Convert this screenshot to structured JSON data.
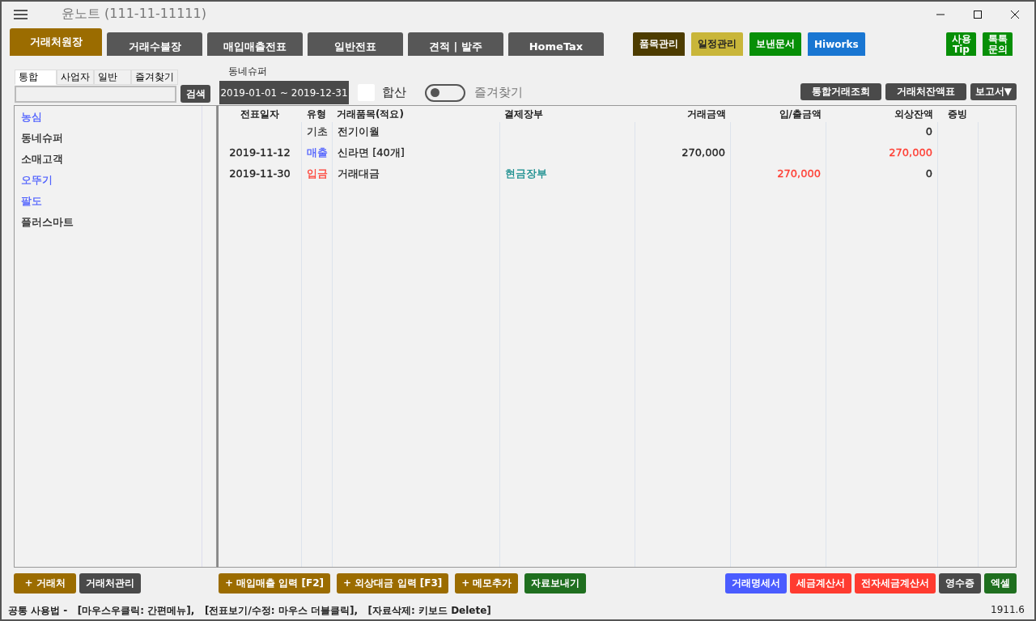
{
  "window": {
    "title": "윤노트 (111-11-11111)"
  },
  "main_tabs": [
    {
      "label": "거래처원장",
      "selected": true
    },
    {
      "label": "거래수불장",
      "selected": false
    },
    {
      "label": "매입매출전표",
      "selected": false
    },
    {
      "label": "일반전표",
      "selected": false
    },
    {
      "label": "견적 | 발주",
      "selected": false
    },
    {
      "label": "HomeTax",
      "selected": false
    }
  ],
  "tool_buttons": [
    {
      "label": "품목관리",
      "color": "#4d3c00"
    },
    {
      "label": "일정관리",
      "color": "#c9b63a"
    },
    {
      "label": "보낸문서",
      "color": "#078f07"
    },
    {
      "label": "Hiworks",
      "color": "#1976d2"
    }
  ],
  "help_buttons": [
    {
      "label": "사용\nTip",
      "color": "#078f07"
    },
    {
      "label": "톡톡\n문의",
      "color": "#078f07"
    }
  ],
  "filter_tabs": [
    {
      "label": "통합",
      "selected": true
    },
    {
      "label": "사업자",
      "selected": false
    },
    {
      "label": "일반",
      "selected": false
    },
    {
      "label": "즐겨찾기",
      "selected": false
    }
  ],
  "search_button": "검색",
  "selected_client": "동네슈퍼",
  "date_range": "2019-01-01 ~ 2019-12-31",
  "sum_checkbox": {
    "label": "합산",
    "checked": false
  },
  "favorite_toggle": {
    "label": "즐겨찾기",
    "on": false
  },
  "report_buttons": [
    {
      "label": "통합거래조회"
    },
    {
      "label": "거래처잔액표"
    },
    {
      "label": "보고서",
      "caret": "▼"
    }
  ],
  "clients": [
    {
      "name": "농심",
      "color": "#4a5cff"
    },
    {
      "name": "동네슈퍼",
      "color": "#222222"
    },
    {
      "name": "소매고객",
      "color": "#222222"
    },
    {
      "name": "오뚜기",
      "color": "#4a5cff"
    },
    {
      "name": "팔도",
      "color": "#4a5cff"
    },
    {
      "name": "플러스마트",
      "color": "#222222"
    }
  ],
  "table": {
    "columns": [
      "전표일자",
      "유형",
      "거래품목(적요)",
      "결제장부",
      "거래금액",
      "입/출금액",
      "외상잔액",
      "증빙"
    ],
    "rows": [
      {
        "type": {
          "text": "기초",
          "color": "#333333"
        },
        "item": "전기이월",
        "balance": {
          "text": "0",
          "color": "#222222"
        }
      },
      {
        "date": "2019-11-12",
        "type": {
          "text": "매출",
          "color": "#4a5cff"
        },
        "item": "신라면 [40개]",
        "amount": "270,000",
        "balance": {
          "text": "270,000",
          "color": "#ff3b30"
        }
      },
      {
        "date": "2019-11-30",
        "type": {
          "text": "입금",
          "color": "#ff3b30"
        },
        "item": "거래대금",
        "ledger": {
          "text": "현금장부",
          "color": "#128a8a"
        },
        "inout": {
          "text": "270,000",
          "color": "#ff3b30"
        },
        "balance": {
          "text": "0",
          "color": "#222222"
        }
      }
    ]
  },
  "bottom_left_buttons": [
    {
      "label": "+ 거래처",
      "color": "#9b6c00"
    },
    {
      "label": "거래처관리",
      "color": "#4a4a4a"
    }
  ],
  "bottom_mid_buttons": [
    {
      "label": "+ 매입매출 입력 [F2]",
      "color": "#9b6c00"
    },
    {
      "label": "+ 외상대금 입력 [F3]",
      "color": "#9b6c00"
    },
    {
      "label": "+ 메모추가",
      "color": "#9b6c00"
    },
    {
      "label": "자료보내기",
      "color": "#1f6f1f"
    }
  ],
  "bottom_right_buttons": [
    {
      "label": "거래명세서",
      "color": "#4a5cff"
    },
    {
      "label": "세금계산서",
      "color": "#ff3b30"
    },
    {
      "label": "전자세금계산서",
      "color": "#ff3b30"
    },
    {
      "label": "영수증",
      "color": "#4a4a4a"
    },
    {
      "label": "엑셀",
      "color": "#1f6f1f"
    }
  ],
  "status_bar": {
    "help": "공통 사용법 -   [마우스우클릭: 간편메뉴],   [전표보기/수정: 마우스 더블클릭],   [자료삭제: 키보드 Delete]",
    "version": "1911.6"
  }
}
